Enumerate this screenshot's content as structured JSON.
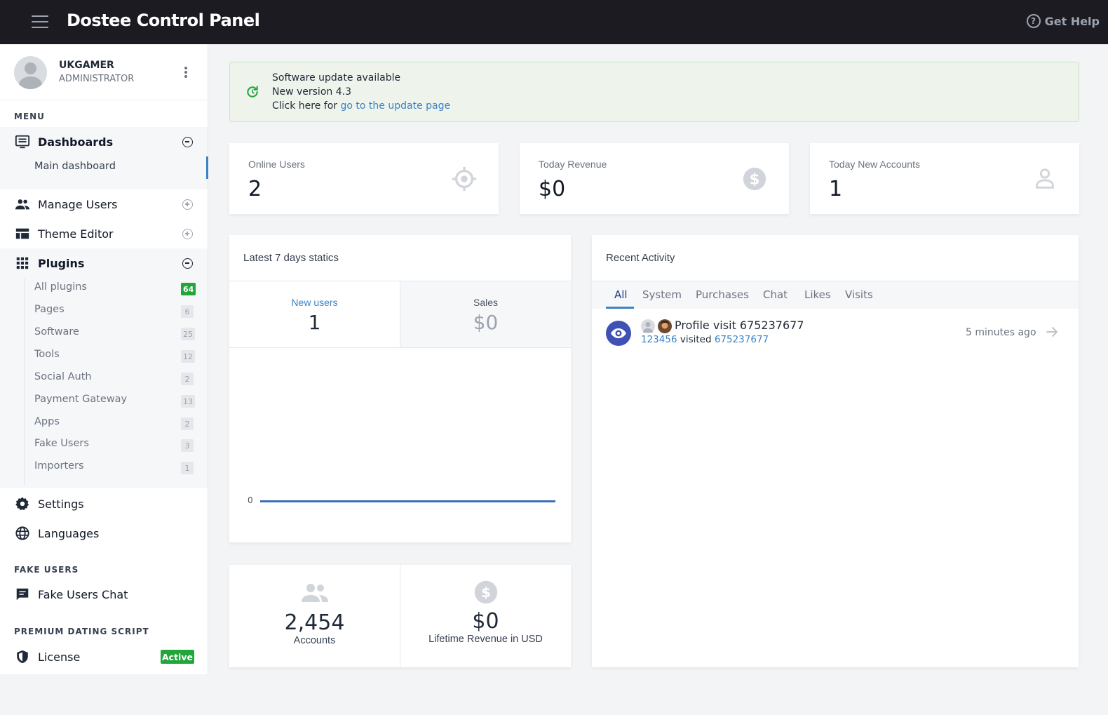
{
  "topbar": {
    "brand": "Dostee Control Panel",
    "help": "Get Help"
  },
  "profile": {
    "name": "UKGAMER",
    "role": "ADMINISTRATOR"
  },
  "sidebar": {
    "menu_label": "MENU",
    "dashboards": "Dashboards",
    "main_dashboard": "Main dashboard",
    "manage_users": "Manage Users",
    "theme_editor": "Theme Editor",
    "plugins": "Plugins",
    "plugin_items": [
      {
        "label": "All plugins",
        "count": "64"
      },
      {
        "label": "Pages",
        "count": "6"
      },
      {
        "label": "Software",
        "count": "25"
      },
      {
        "label": "Tools",
        "count": "12"
      },
      {
        "label": "Social Auth",
        "count": "2"
      },
      {
        "label": "Payment Gateway",
        "count": "13"
      },
      {
        "label": "Apps",
        "count": "2"
      },
      {
        "label": "Fake Users",
        "count": "3"
      },
      {
        "label": "Importers",
        "count": "1"
      }
    ],
    "settings": "Settings",
    "languages": "Languages",
    "fake_users_label": "FAKE USERS",
    "fake_users_chat": "Fake Users Chat",
    "premium_label": "PREMIUM DATING SCRIPT",
    "license": "License",
    "license_status": "Active"
  },
  "alert": {
    "line1": "Software update available",
    "line2": "New version 4.3",
    "line3_prefix": "Click here for ",
    "line3_link": "go to the update page"
  },
  "stats": {
    "online_users": {
      "label": "Online Users",
      "value": "2"
    },
    "today_revenue": {
      "label": "Today Revenue",
      "value": "$0"
    },
    "today_new_accounts": {
      "label": "Today New Accounts",
      "value": "1"
    }
  },
  "weekly": {
    "title": "Latest 7 days statics",
    "new_users_label": "New users",
    "new_users_value": "1",
    "sales_label": "Sales",
    "sales_value": "$0",
    "chart_zero": "0"
  },
  "totals": {
    "accounts_value": "2,454",
    "accounts_label": "Accounts",
    "revenue_value": "$0",
    "revenue_label": "Lifetime Revenue in USD"
  },
  "activity": {
    "title": "Recent Activity",
    "tabs": [
      "All",
      "System",
      "Purchases",
      "Chat",
      "Likes",
      "Visits"
    ],
    "items": [
      {
        "title": "Profile visit 675237677",
        "actor": "123456",
        "verb": " visited ",
        "target": "675237677",
        "time": "5 minutes ago"
      }
    ]
  },
  "colors": {
    "topbar": "#1c1b22",
    "accent": "#3b82c4",
    "success": "#22a63b",
    "activity_icon": "#3f51b5"
  }
}
